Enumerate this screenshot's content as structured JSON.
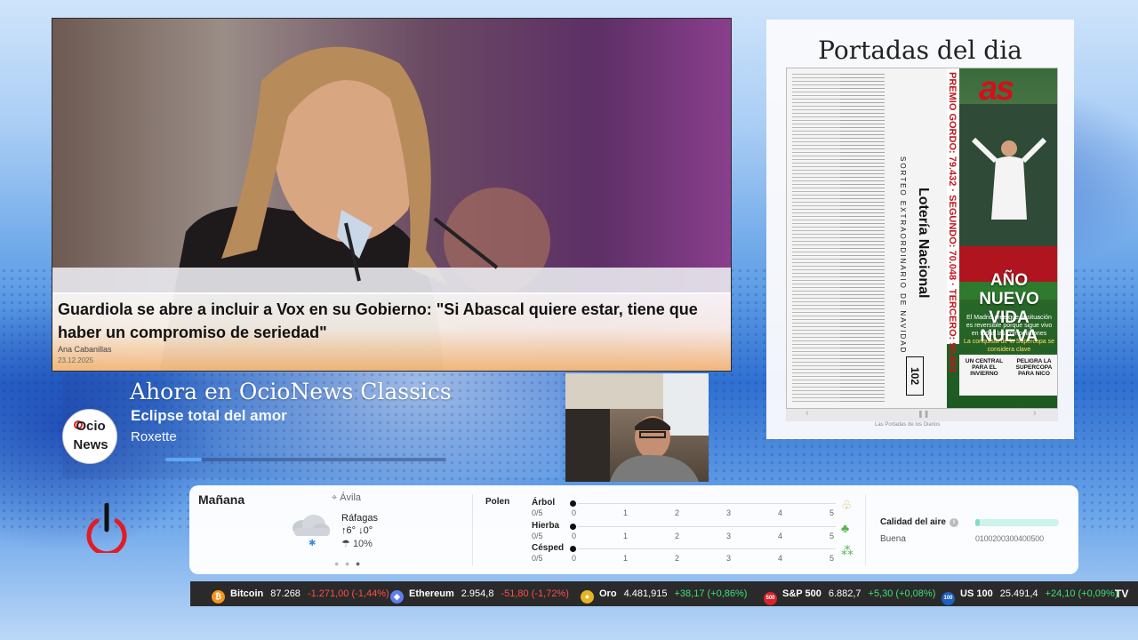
{
  "news": {
    "headline": "Guardiola se abre a incluir a Vox en su Gobierno: \"Si Abascal quiere estar, tiene que haber un compromiso de seriedad\"",
    "author": "Ana Cabanillas",
    "date": "23.12.2025"
  },
  "now_playing": {
    "title": "Ahora en OcioNews Classics",
    "song": "Eclipse total del amor",
    "artist": "Roxette",
    "progress": 0.13,
    "logo_top": "Ocio",
    "logo_bottom": "News"
  },
  "portadas": {
    "title": "Portadas del dia",
    "lottery": {
      "name": "Lotería Nacional",
      "subtitle": "SORTEO EXTRAORDINARIO DE NAVIDAD",
      "number": "102"
    },
    "as": {
      "logo": "as",
      "prizes": "PREMIO GORDO: 79.432 · SEGUNDO: 70.048 · TERCERO: 90.693",
      "headline_1": "AÑO NUEVO",
      "headline_2": "VIDA NUEVA",
      "deck": "El Madrid cree que la situación es reversible porque sigue vivo en todas las competiciones",
      "deck_2": "La conquista de la Supercopa se considera clave",
      "band_left": "UN CENTRAL PARA EL INVIERNO",
      "band_right": "PELIGRA LA SUPERCOPA PARA NICO"
    },
    "footer": "Las Portadas de los Diarios"
  },
  "weather": {
    "day": "Mañana",
    "location": "Ávila",
    "gusts_label": "Ráfagas",
    "temp_high": "6°",
    "temp_low": "0°",
    "rain": "10%",
    "pollen_label": "Polen",
    "pollen": [
      {
        "name": "Árbol",
        "value": "0/5",
        "level": 0,
        "icon": "tree-icon"
      },
      {
        "name": "Hierba",
        "value": "0/5",
        "level": 0,
        "icon": "grass-icon"
      },
      {
        "name": "Césped",
        "value": "0/5",
        "level": 0,
        "icon": "lawn-icon"
      }
    ],
    "scale": [
      "0",
      "1",
      "2",
      "3",
      "4",
      "5"
    ],
    "air_quality_label": "Calidad del aire",
    "air_quality_status": "Buena",
    "air_quality_level": 0.05,
    "air_scale": "0100200300400500"
  },
  "ticker": [
    {
      "name": "Bitcoin",
      "price": "87.268",
      "change": "-1.271,00 (-1,44%)",
      "direction": "down",
      "icon": "bitcoin-icon",
      "color": "#f7931a",
      "glyph": "₿"
    },
    {
      "name": "Ethereum",
      "price": "2.954,8",
      "change": "-51,80 (-1,72%)",
      "direction": "down",
      "icon": "ethereum-icon",
      "color": "#627eea",
      "glyph": "◆"
    },
    {
      "name": "Oro",
      "price": "4.481,915",
      "change": "+38,17 (+0,86%)",
      "direction": "up",
      "icon": "gold-icon",
      "color": "#e6b422",
      "glyph": "●"
    },
    {
      "name": "S&P 500",
      "price": "6.882,7",
      "change": "+5,30 (+0,08%)",
      "direction": "up",
      "icon": "sp500-icon",
      "color": "#d8232a",
      "glyph": "500"
    },
    {
      "name": "US 100",
      "price": "25.491,4",
      "change": "+24,10 (+0,09%)",
      "direction": "up",
      "icon": "us100-icon",
      "color": "#1f5fbf",
      "glyph": "100"
    }
  ],
  "ticker_brand": "TV"
}
